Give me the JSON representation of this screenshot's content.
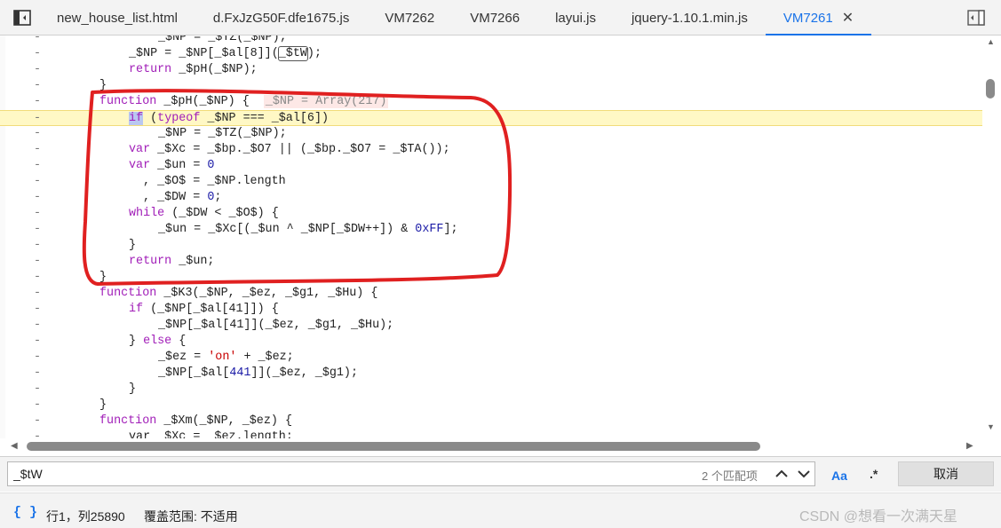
{
  "tabs": [
    {
      "label": "new_house_list.html",
      "active": false
    },
    {
      "label": "d.FxJzG50F.dfe1675.js",
      "active": false
    },
    {
      "label": "VM7262",
      "active": false
    },
    {
      "label": "VM7266",
      "active": false
    },
    {
      "label": "layui.js",
      "active": false
    },
    {
      "label": "jquery-1.10.1.min.js",
      "active": false
    },
    {
      "label": "VM7261",
      "active": true
    }
  ],
  "icons": {
    "toggle_navigator": "sidebar-toggle-icon",
    "toggle_debugger": "debugger-toggle-icon",
    "close_tab": "close-icon"
  },
  "gutter_marker": "-",
  "code": {
    "l1": "_$NP = _$TZ(_$NP);",
    "l2a": "_$NP = _$NP[_$al[8]](",
    "l2b": "_$tW",
    "l2c": ");",
    "l3a": "return",
    "l3b": " _$pH(_$NP);",
    "l4": "}",
    "l5a": "function",
    "l5b": " _$pH(_$NP) {  ",
    "l5c": "_$NP = Array(217)",
    "l6a": "if",
    "l6b": " (",
    "l6c": "typeof",
    "l6d": " _$NP === _$al[6])",
    "l7": "_$NP = _$TZ(_$NP);",
    "l8a": "var",
    "l8b": " _$Xc = _$bp._$O7 || (_$bp._$O7 = _$TA());",
    "l9a": "var",
    "l9b": " _$un = ",
    "l9c": "0",
    "l10": ", _$O$ = _$NP.length",
    "l11a": ", _$DW = ",
    "l11b": "0",
    "l11c": ";",
    "l12a": "while",
    "l12b": " (_$DW < _$O$) {",
    "l13a": "_$un = _$Xc[(_$un ^ _$NP[_$DW++]) & ",
    "l13b": "0xFF",
    "l13c": "];",
    "l14": "}",
    "l15a": "return",
    "l15b": " _$un;",
    "l16": "}",
    "l17a": "function",
    "l17b": " _$K3(_$NP, _$ez, _$g1, _$Hu) {",
    "l18a": "if",
    "l18b": " (_$NP[_$al[41]]) {",
    "l19": "_$NP[_$al[41]](_$ez, _$g1, _$Hu);",
    "l20a": "} ",
    "l20b": "else",
    "l20c": " {",
    "l21a": "_$ez = ",
    "l21b": "'on'",
    "l21c": " + _$ez;",
    "l22a": "_$NP[_$al[",
    "l22b": "441",
    "l22c": "]](_$ez, _$g1);",
    "l23": "}",
    "l24": "}",
    "l25a": "function",
    "l25b": " _$Xm(_$NP, _$ez) {",
    "l26": "var _$Xc = _$ez.length;"
  },
  "search": {
    "value": "_$tW",
    "match_count": "2 个匹配项",
    "case_label": "Aa",
    "regex_label": ".*",
    "cancel_label": "取消"
  },
  "status": {
    "braces": "{ }",
    "position": "行1，列25890",
    "coverage": "覆盖范围: 不适用"
  },
  "watermark": "CSDN @想看一次满天星",
  "colors": {
    "accent": "#1a73e8",
    "keyword": "#a11eb8",
    "string": "#c80000",
    "number": "#1a1aa6",
    "highlight_line": "#fff8c5",
    "annotation": "#e02020"
  }
}
